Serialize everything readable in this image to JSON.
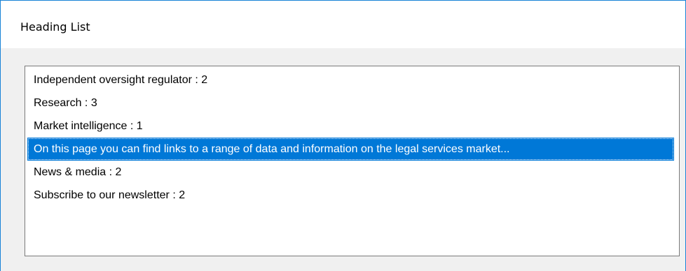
{
  "window": {
    "title": "Heading List"
  },
  "list": {
    "items": [
      {
        "label": "Independent oversight regulator : 2",
        "selected": false
      },
      {
        "label": "Research : 3",
        "selected": false
      },
      {
        "label": "Market intelligence : 1",
        "selected": false
      },
      {
        "label": "On this page you can find links to a range of data and information on the legal services market...",
        "selected": true
      },
      {
        "label": "News & media : 2",
        "selected": false
      },
      {
        "label": "Subscribe to our newsletter : 2",
        "selected": false
      }
    ]
  },
  "colors": {
    "selection_bg": "#0078d7",
    "selection_fg": "#ffffff",
    "window_border": "#1883d7",
    "dialog_bg": "#f0f0f0"
  }
}
